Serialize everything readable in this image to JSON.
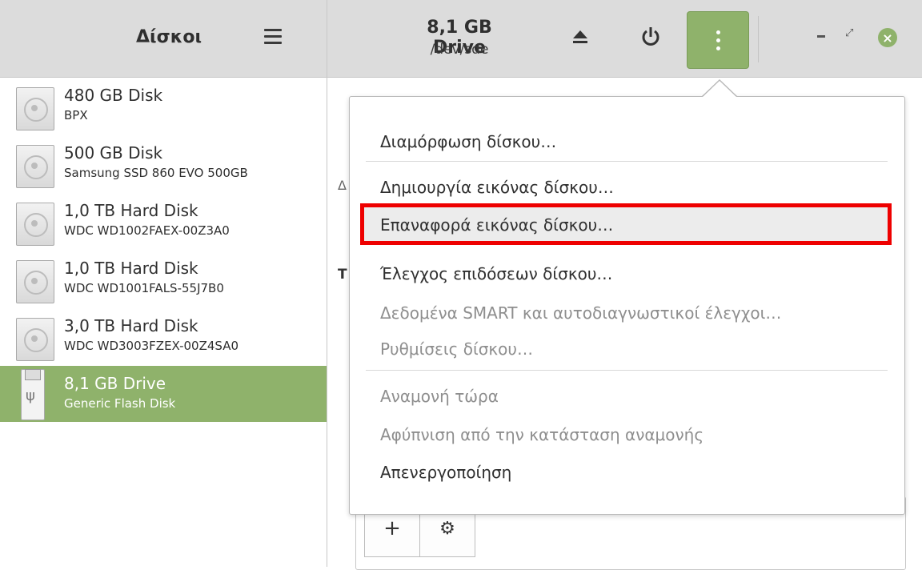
{
  "sidebar": {
    "title": "Δίσκοι",
    "disks": [
      {
        "name": "480 GB Disk",
        "model": "BPX"
      },
      {
        "name": "500 GB Disk",
        "model": "Samsung SSD 860 EVO 500GB"
      },
      {
        "name": "1,0 TB Hard Disk",
        "model": "WDC WD1002FAEX-00Z3A0"
      },
      {
        "name": "1,0 TB Hard Disk",
        "model": "WDC WD1001FALS-55J7B0"
      },
      {
        "name": "3,0 TB Hard Disk",
        "model": "WDC WD3003FZEX-00Z4SA0"
      },
      {
        "name": "8,1 GB Drive",
        "model": "Generic Flash Disk",
        "selected": true
      }
    ]
  },
  "header": {
    "drive_title": "8,1 GB Drive",
    "drive_device": "/dev/sde"
  },
  "background": {
    "letter_d": "Δ",
    "letter_t": "T"
  },
  "menu": {
    "items": [
      {
        "label": "Διαμόρφωση δίσκου…",
        "enabled": true
      },
      {
        "label": "Δημιουργία εικόνας δίσκου…",
        "enabled": true
      },
      {
        "label": "Επαναφορά εικόνας δίσκου…",
        "enabled": true,
        "highlighted": true
      },
      {
        "label": "Έλεγχος επιδόσεων δίσκου…",
        "enabled": true
      },
      {
        "label": "Δεδομένα SMART και αυτοδιαγνωστικοί έλεγχοι…",
        "enabled": false
      },
      {
        "label": "Ρυθμίσεις δίσκου…",
        "enabled": false
      },
      {
        "label": "Αναμονή τώρα",
        "enabled": false
      },
      {
        "label": "Αφύπνιση από την κατάσταση αναμονής",
        "enabled": false
      },
      {
        "label": "Απενεργοποίηση",
        "enabled": true
      }
    ]
  },
  "toolbar": {
    "add_label": "+",
    "options_label": "⚙"
  },
  "colors": {
    "accent": "#8fb26b",
    "highlight_border": "#ee0000"
  }
}
